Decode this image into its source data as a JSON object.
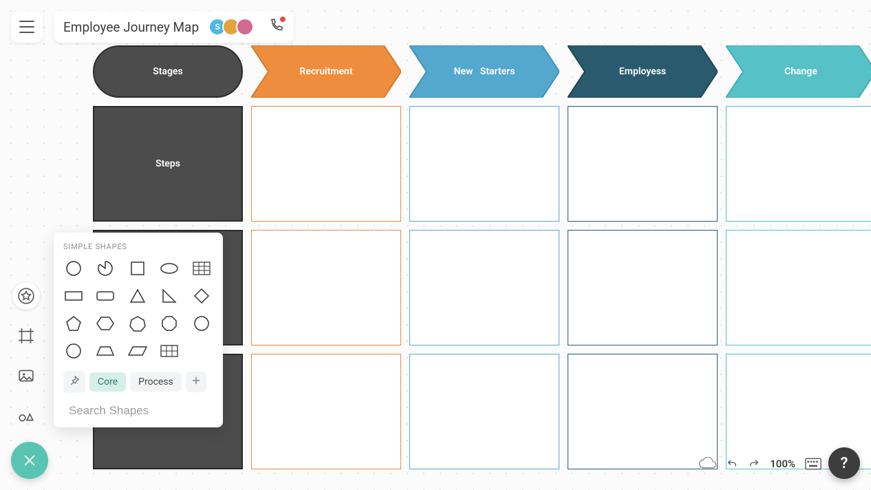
{
  "header": {
    "title": "Employee Journey Map",
    "avatars": [
      {
        "label": "S",
        "bg": "#4ab9e6"
      },
      {
        "label": "",
        "bg": "#e6a23c"
      },
      {
        "label": "",
        "bg": "#d06b8f"
      }
    ]
  },
  "shapes_panel": {
    "title": "SIMPLE SHAPES",
    "tabs": {
      "core": "Core",
      "process": "Process"
    },
    "search_placeholder": "Search Shapes"
  },
  "diagram": {
    "stages_label": "Stages",
    "steps_label": "Steps",
    "columns": [
      {
        "label": "Recruitment",
        "fill": "#ee8d3d",
        "stroke": "#d77a2b",
        "cell": "c-orange"
      },
      {
        "label": "New   Starters",
        "fill": "#54a8ce",
        "stroke": "#3f93ba",
        "cell": "c-blue"
      },
      {
        "label": "Employess",
        "fill": "#2a5a6e",
        "stroke": "#1f4656",
        "cell": "c-darkblue"
      },
      {
        "label": "Change",
        "fill": "#56c1c7",
        "stroke": "#3fb1b8",
        "cell": "c-teal"
      }
    ]
  },
  "footer": {
    "zoom": "100%",
    "help": "?"
  }
}
